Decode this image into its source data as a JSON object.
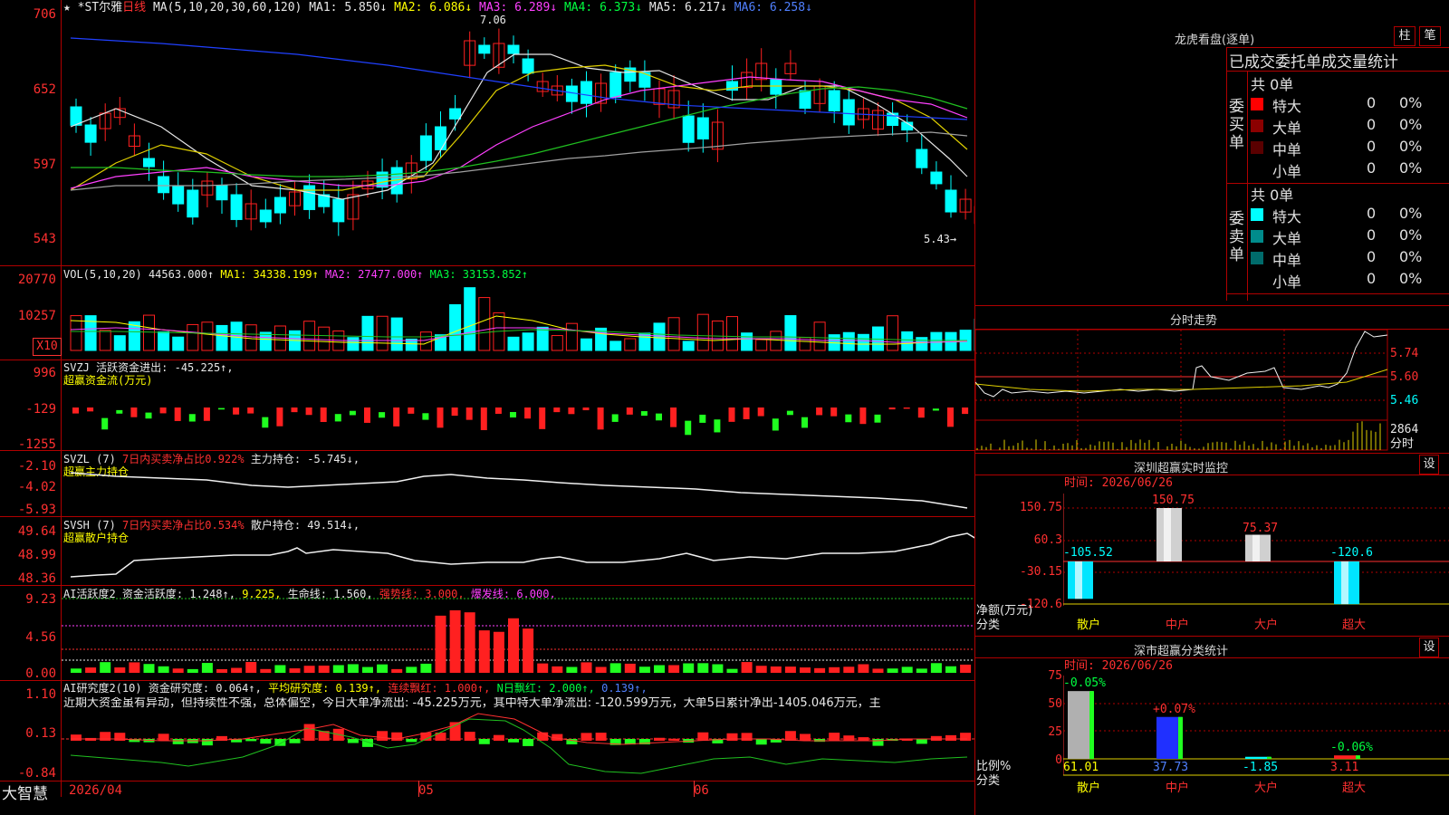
{
  "header": {
    "star": "★",
    "name": "*ST尔雅",
    "period": "日线",
    "ma_label": "MA(5,10,20,30,60,120)",
    "ma1": "MA1: 5.850↓",
    "ma2": "MA2: 6.086↓",
    "ma3": "MA3: 6.289↓",
    "ma4": "MA4: 6.373↓",
    "ma5": "MA5: 6.217↓",
    "ma6": "MA6: 6.258↓",
    "high_mark": "7.06",
    "low_mark": "5.43→"
  },
  "price_axis": [
    "706",
    "652",
    "597",
    "543"
  ],
  "vol": {
    "label": "VOL(5,10,20)",
    "value": "44563.000↑",
    "ma1": "MA1: 34338.199↑",
    "ma2": "MA2: 27477.000↑",
    "ma3": "MA3: 33153.852↑",
    "axis": [
      "20770",
      "10257",
      "X10"
    ]
  },
  "svzj": {
    "label": "SVZJ",
    "text1": "活跃资金进出: -45.225↑,",
    "text2": "超赢资金流(万元)",
    "axis": [
      "996",
      "-129",
      "-1255"
    ]
  },
  "svzl": {
    "label": "SVZL (7)",
    "text1": "7日内买卖净占比0.922%",
    "text2": "主力持仓: -5.745↓,",
    "text3": "超赢主力持仓",
    "axis": [
      "-2.10",
      "-4.02",
      "-5.93"
    ]
  },
  "svsh": {
    "label": "SVSH (7)",
    "text1": "7日内买卖净占比0.534%",
    "text2": "散户持仓: 49.514↓,",
    "text3": "超赢散户持仓",
    "axis": [
      "49.64",
      "48.99",
      "48.36"
    ]
  },
  "ai_active": {
    "label": "AI活跃度2",
    "text1": "资金活跃度: 1.248↑,",
    "text2": "9.225,",
    "text3": "生命线: 1.560,",
    "text4": "强势线: 3.000,",
    "text5": "爆发线: 6.000,",
    "axis": [
      "9.23",
      "4.56",
      "0.00"
    ]
  },
  "ai_research": {
    "label": "AI研究度2(10)",
    "text1": "资金研究度: 0.064↑,",
    "text2": "平均研究度: 0.139↑,",
    "text3": "连续飘红: 1.000↑,",
    "text4": "N日飘红: 2.000↑,",
    "text5": "0.139↑,",
    "comment": "近期大资金虽有异动，但持续性不强，总体偏空，今日大单净流出: -45.225万元，其中特大单净流出: -120.599万元，大单5日累计净出-1405.046万元，主",
    "axis": [
      "1.10",
      "0.13",
      "-0.84"
    ]
  },
  "bottom": {
    "brand": "大智慧",
    "date1": "2026/04",
    "date2": "05",
    "date3": "06"
  },
  "right": {
    "lhb_title": "龙虎看盘(逐单)",
    "btn_bar": "柱",
    "btn_pen": "笔",
    "tabs": "已成交委托单成交量统计",
    "buy_side": "委买单",
    "sell_side": "委卖单",
    "buy_total": "共 0单",
    "sell_total": "共 0单",
    "rows": [
      {
        "name": "特大",
        "count": "0",
        "pct": "0%"
      },
      {
        "name": "大单",
        "count": "0",
        "pct": "0%"
      },
      {
        "name": "中单",
        "count": "0",
        "pct": "0%"
      },
      {
        "name": "小单",
        "count": "0",
        "pct": "0%"
      }
    ],
    "fenshi_title": "分时走势",
    "fenshi_axis": [
      "5.74",
      "5.60",
      "5.46",
      "2864",
      "分时"
    ],
    "sz_title": "深圳超赢实时监控",
    "sz_btn": "设",
    "sz_time": "时间: 2026/06/26",
    "sz_axis": [
      "150.75",
      "60.3",
      "-30.15",
      "-120.6"
    ],
    "sz_values": [
      "-105.52",
      "150.75",
      "75.37",
      "-120.6"
    ],
    "sz_ylabel": "净额(万元)",
    "sz_xlabel": "分类",
    "categories": [
      "散户",
      "中户",
      "大户",
      "超大"
    ],
    "fl_title": "深市超赢分类统计",
    "fl_btn": "设",
    "fl_time": "时间: 2026/06/26",
    "fl_axis": [
      "75",
      "50",
      "25",
      "0"
    ],
    "fl_pct": [
      "-0.05%",
      "+0.07%",
      "-0.06%"
    ],
    "fl_values": [
      "61.01",
      "37.73",
      "-1.85",
      "3.11"
    ],
    "fl_ylabel": "比例%",
    "fl_xlabel": "分类"
  },
  "colors": {
    "up": "#ff2020",
    "down": "#00ffff",
    "grid": "#b00000"
  }
}
